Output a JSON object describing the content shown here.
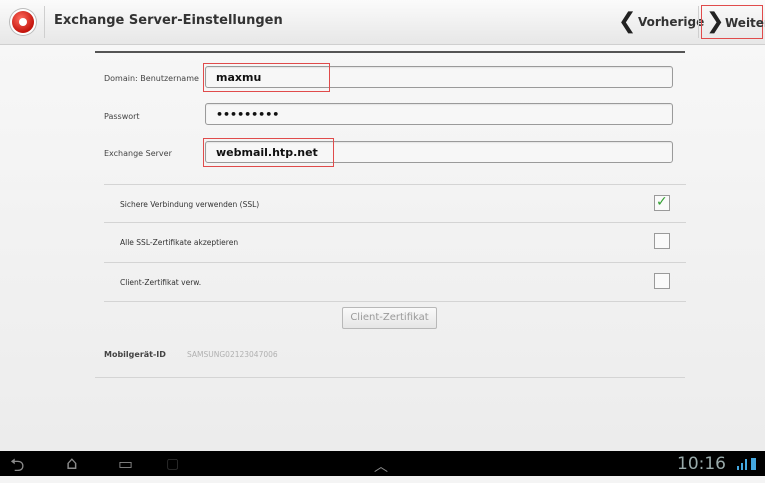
{
  "header": {
    "app_icon": "exchange-app-icon",
    "title": "Exchange Server-Einstellungen",
    "prev_label": "Vorherige",
    "next_label": "Weiter"
  },
  "form": {
    "domain_label": "Domain: Benutzername",
    "domain_value": "maxmu",
    "password_label": "Passwort",
    "password_value": "•••••••••",
    "server_label": "Exchange Server",
    "server_value": "webmail.htp.net"
  },
  "options": [
    {
      "label": "Sichere Verbindung verwenden (SSL)",
      "checked": true
    },
    {
      "label": "Alle SSL-Zertifikate akzeptieren",
      "checked": false
    },
    {
      "label": "Client-Zertifikat verw.",
      "checked": false
    }
  ],
  "client_cert_button": "Client-Zertifikat",
  "device": {
    "label": "Mobilgerät-ID",
    "value": "SAMSUNG02123047006"
  },
  "system_bar": {
    "clock": "10:16"
  },
  "colors": {
    "highlight": "#e04b4b",
    "check_green": "#33a133"
  }
}
